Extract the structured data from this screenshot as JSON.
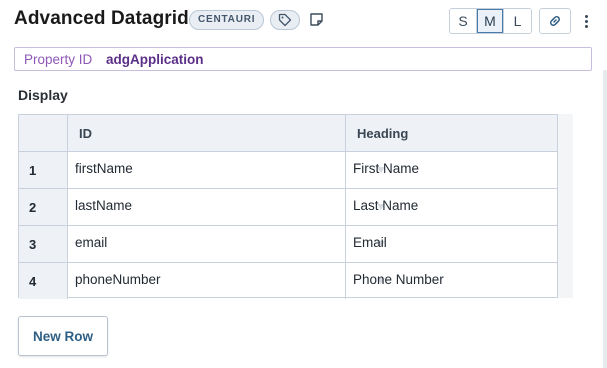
{
  "header": {
    "title": "Advanced Datagrid",
    "badge": "CENTAURI",
    "tag_icon": "tag-icon",
    "note_icon": "note-icon",
    "sizes": [
      "S",
      "M",
      "L"
    ],
    "active_size": "M",
    "link_icon": "link-icon",
    "menu_icon": "kebab-menu-icon"
  },
  "property": {
    "label": "Property ID",
    "value": "adgApplication"
  },
  "section": {
    "label": "Display"
  },
  "grid": {
    "columns": [
      "ID",
      "Heading"
    ],
    "rows": [
      {
        "num": "1",
        "id": "firstName",
        "heading": "First Name"
      },
      {
        "num": "2",
        "id": "lastName",
        "heading": "Last Name"
      },
      {
        "num": "3",
        "id": "email",
        "heading": "Email"
      },
      {
        "num": "4",
        "id": "phoneNumber",
        "heading": "Phone Number"
      }
    ]
  },
  "actions": {
    "new_row": "New Row"
  },
  "colors": {
    "accent": "#4a7aa7",
    "property_label": "#8e58b8",
    "property_value": "#5b2f88",
    "button_text": "#2f5f85"
  }
}
